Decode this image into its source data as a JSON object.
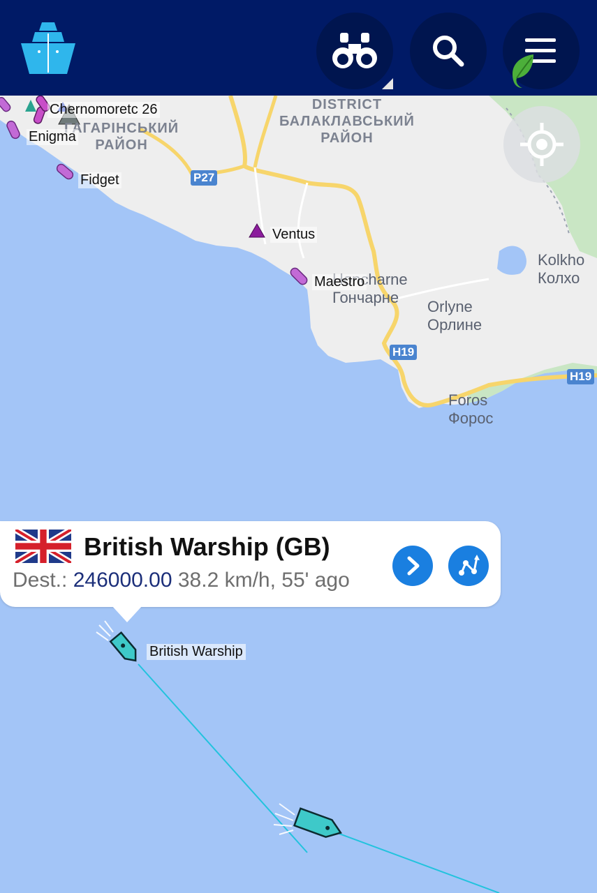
{
  "header": {
    "logo_icon": "ship-logo-icon",
    "buttons": [
      {
        "icon": "binoculars-icon"
      },
      {
        "icon": "search-icon"
      },
      {
        "icon": "menu-icon"
      }
    ]
  },
  "map": {
    "places": [
      {
        "latin": "Honcharne",
        "cyrillic": "Гончарне"
      },
      {
        "latin": "Orlyne",
        "cyrillic": "Орлине"
      },
      {
        "latin": "Foros",
        "cyrillic": "Форос"
      },
      {
        "latin": "Kolkho",
        "cyrillic": "Колхо"
      }
    ],
    "districts": [
      {
        "line1": "DISTRICT",
        "line2": "БАЛАКЛАВСЬКИЙ",
        "line3": "РАЙОН"
      },
      {
        "line1": "ГАГАРІНСЬКИЙ",
        "line2": "РАЙОН"
      }
    ],
    "roads": [
      "P27",
      "H19",
      "H19"
    ],
    "vessels": [
      "Chernomoretc 26",
      "Enigma",
      "Fidget",
      "Ventus",
      "Maestro",
      "British Warship"
    ]
  },
  "popup": {
    "flag": "uk-flag-icon",
    "title": "British Warship (GB)",
    "dest_label": "Dest.:",
    "dest_value": "246000.00",
    "speed_age": "38.2 km/h, 55' ago"
  },
  "colors": {
    "header": "#001a66",
    "sea": "#a3c5f7",
    "land": "#eeeeee",
    "accent": "#1a7fe0",
    "track": "#22c3dd",
    "vessel_teal": "#3ec9c9",
    "vessel_purple": "#c26ad6"
  }
}
